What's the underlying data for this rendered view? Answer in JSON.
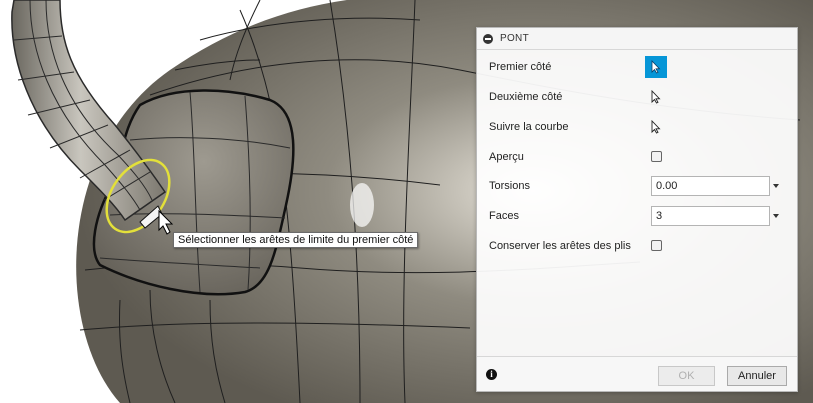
{
  "viewport": {
    "tooltip": "Sélectionner les arêtes de limite du premier côté",
    "cursor_icon": "arrow-cursor-icon"
  },
  "dialog": {
    "title": "PONT",
    "collapse_icon": "minus-circle-icon",
    "rows": {
      "first_side": {
        "label": "Premier côté",
        "icon": "select-arrow-icon",
        "active": true
      },
      "second_side": {
        "label": "Deuxième côté",
        "icon": "select-arrow-icon",
        "active": false
      },
      "follow_curve": {
        "label": "Suivre la courbe",
        "icon": "select-arrow-icon",
        "active": false
      },
      "preview": {
        "label": "Aperçu",
        "checked": false
      },
      "twists": {
        "label": "Torsions",
        "value": "0.00"
      },
      "faces": {
        "label": "Faces",
        "value": "3"
      },
      "keep_crease": {
        "label": "Conserver les arêtes des plis",
        "checked": false
      }
    },
    "footer": {
      "info_icon": "info-icon",
      "ok_label": "OK",
      "ok_enabled": false,
      "cancel_label": "Annuler"
    }
  },
  "colors": {
    "accent": "#0696d7",
    "selection_ring": "#e3e03a",
    "model_surface": "#8a867b"
  }
}
